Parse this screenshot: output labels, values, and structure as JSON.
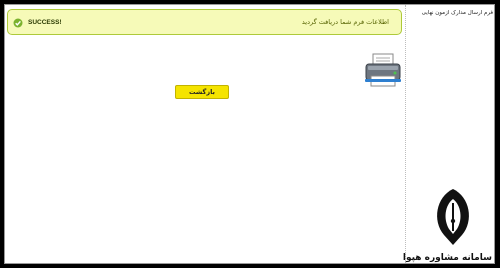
{
  "sidebar": {
    "title": "فرم ارسال مدارک آزمون نهایی"
  },
  "alert": {
    "status_label": "SUCCESS!",
    "message": "اطلاعات فرم شما دریافت گردید",
    "icon": "check-icon",
    "colors": {
      "background": "#f6fab8",
      "border": "#aeca3a"
    }
  },
  "toolbar": {
    "print_icon": "printer-icon"
  },
  "actions": {
    "back_label": "بازگشت",
    "back_color": "#f5e400"
  },
  "logo": {
    "text": "سامانه مشاوره هپوا"
  }
}
